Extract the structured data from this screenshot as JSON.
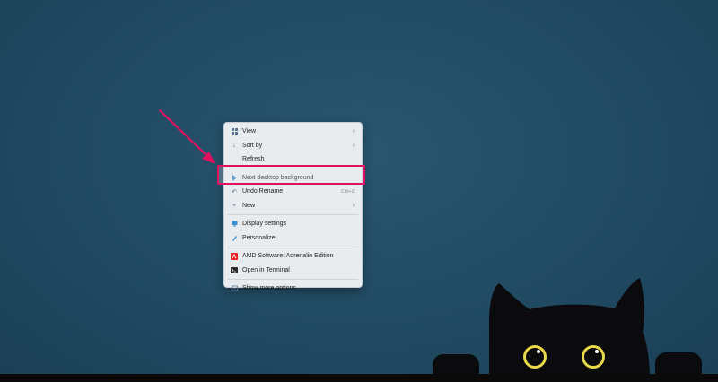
{
  "context_menu": {
    "items": [
      {
        "label": "View",
        "icon": "view-grid-icon",
        "submenu": true
      },
      {
        "label": "Sort by",
        "icon": "sort-icon",
        "submenu": true
      },
      {
        "label": "Refresh",
        "icon": "",
        "submenu": false
      },
      {
        "label": "Next desktop background",
        "icon": "next-background-icon",
        "submenu": false
      },
      {
        "label": "Undo Rename",
        "icon": "undo-icon",
        "shortcut": "Ctrl+Z"
      },
      {
        "label": "New",
        "icon": "plus-icon",
        "submenu": true
      },
      {
        "label": "Display settings",
        "icon": "display-icon",
        "submenu": false
      },
      {
        "label": "Personalize",
        "icon": "personalize-icon",
        "submenu": false
      },
      {
        "label": "AMD Software: Adrenalin Edition",
        "icon": "amd-icon",
        "submenu": false
      },
      {
        "label": "Open in Terminal",
        "icon": "terminal-icon",
        "submenu": false
      },
      {
        "label": "Show more options",
        "icon": "more-options-icon",
        "submenu": false
      }
    ],
    "chevron": "›"
  },
  "colors": {
    "desktop": "#214a63",
    "menu_bg": "#e9ecef",
    "highlight": "#e0115f",
    "amd_red": "#ed1c24",
    "cat_eye": "#e8d84a"
  }
}
